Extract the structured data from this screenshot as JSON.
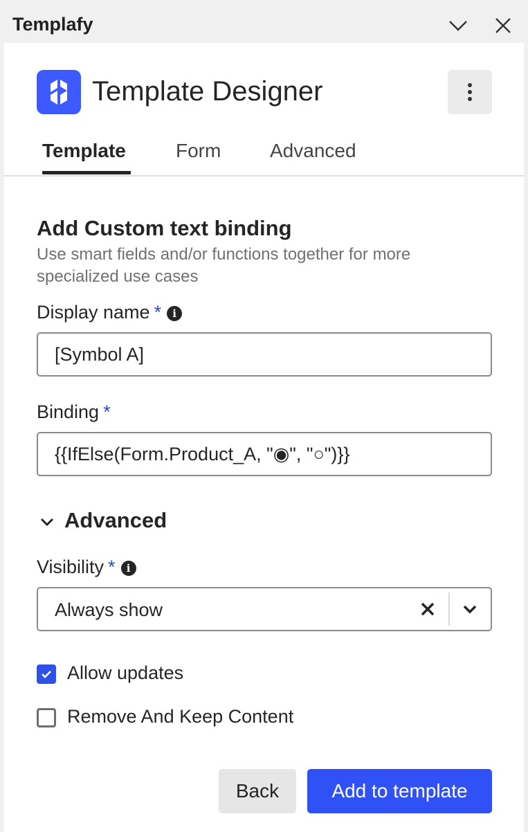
{
  "window": {
    "app_name": "Templafy",
    "minimize_icon": "chevron-down-icon",
    "close_icon": "close-icon"
  },
  "header": {
    "title": "Template Designer",
    "logo_icon": "templafy-logo",
    "menu_icon": "more-vertical-icon"
  },
  "tabs": [
    {
      "label": "Template",
      "active": true
    },
    {
      "label": "Form",
      "active": false
    },
    {
      "label": "Advanced",
      "active": false
    }
  ],
  "form": {
    "title": "Add Custom text binding",
    "description": "Use smart fields and/or functions together for more specialized use cases",
    "display_name": {
      "label": "Display name",
      "required": "*",
      "value": "[Symbol A]"
    },
    "binding": {
      "label": "Binding",
      "required": "*",
      "value": "{{IfElse(Form.Product_A, \"◉\", \"○\")}}"
    },
    "advanced": {
      "label": "Advanced",
      "expanded": true,
      "visibility": {
        "label": "Visibility",
        "required": "*",
        "value": "Always show"
      },
      "allow_updates": {
        "label": "Allow updates",
        "checked": true
      },
      "remove_keep_content": {
        "label": "Remove And Keep Content",
        "checked": false
      }
    }
  },
  "footer": {
    "back_label": "Back",
    "submit_label": "Add to template"
  },
  "colors": {
    "accent": "#3051f5",
    "text": "#252525",
    "muted": "#707070"
  }
}
